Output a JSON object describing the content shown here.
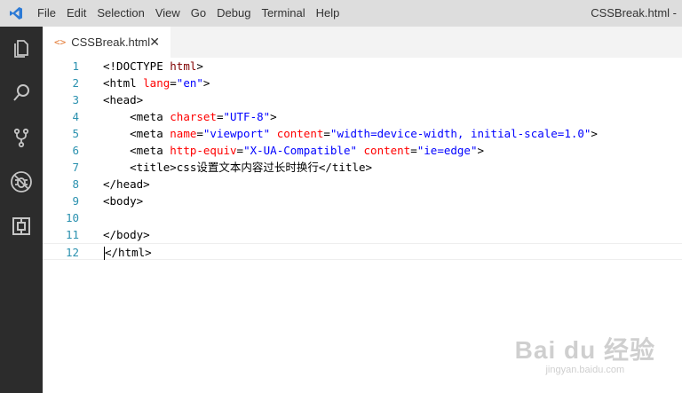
{
  "menu": [
    "File",
    "Edit",
    "Selection",
    "View",
    "Go",
    "Debug",
    "Terminal",
    "Help"
  ],
  "window_title": "CSSBreak.html -",
  "activity_icons": [
    "files-icon",
    "search-icon",
    "source-control-icon",
    "debug-icon",
    "extensions-icon"
  ],
  "tab": {
    "icon": "<>",
    "label": "CSSBreak.html",
    "close": "✕"
  },
  "lines": [
    {
      "n": "1",
      "parts": [
        {
          "c": "k",
          "t": "<!DOCTYPE "
        },
        {
          "c": "t",
          "t": "html"
        },
        {
          "c": "k",
          "t": ">"
        }
      ]
    },
    {
      "n": "2",
      "parts": [
        {
          "c": "k",
          "t": "<html "
        },
        {
          "c": "a",
          "t": "lang"
        },
        {
          "c": "k",
          "t": "="
        },
        {
          "c": "v",
          "t": "\"en\""
        },
        {
          "c": "k",
          "t": ">"
        }
      ]
    },
    {
      "n": "3",
      "parts": [
        {
          "c": "k",
          "t": "<head>"
        }
      ]
    },
    {
      "n": "4",
      "parts": [
        {
          "c": "k",
          "t": "    <meta "
        },
        {
          "c": "a",
          "t": "charset"
        },
        {
          "c": "k",
          "t": "="
        },
        {
          "c": "v",
          "t": "\"UTF-8\""
        },
        {
          "c": "k",
          "t": ">"
        }
      ]
    },
    {
      "n": "5",
      "parts": [
        {
          "c": "k",
          "t": "    <meta "
        },
        {
          "c": "a",
          "t": "name"
        },
        {
          "c": "k",
          "t": "="
        },
        {
          "c": "v",
          "t": "\"viewport\""
        },
        {
          "c": "k",
          "t": " "
        },
        {
          "c": "a",
          "t": "content"
        },
        {
          "c": "k",
          "t": "="
        },
        {
          "c": "v",
          "t": "\"width=device-width, initial-scale=1.0\""
        },
        {
          "c": "k",
          "t": ">"
        }
      ]
    },
    {
      "n": "6",
      "parts": [
        {
          "c": "k",
          "t": "    <meta "
        },
        {
          "c": "a",
          "t": "http-equiv"
        },
        {
          "c": "k",
          "t": "="
        },
        {
          "c": "v",
          "t": "\"X-UA-Compatible\""
        },
        {
          "c": "k",
          "t": " "
        },
        {
          "c": "a",
          "t": "content"
        },
        {
          "c": "k",
          "t": "="
        },
        {
          "c": "v",
          "t": "\"ie=edge\""
        },
        {
          "c": "k",
          "t": ">"
        }
      ]
    },
    {
      "n": "7",
      "parts": [
        {
          "c": "k",
          "t": "    <title>css设置文本内容过长时换行</title>"
        }
      ]
    },
    {
      "n": "8",
      "parts": [
        {
          "c": "k",
          "t": "</head>"
        }
      ]
    },
    {
      "n": "9",
      "parts": [
        {
          "c": "k",
          "t": "<body>"
        }
      ]
    },
    {
      "n": "10",
      "parts": []
    },
    {
      "n": "11",
      "parts": [
        {
          "c": "k",
          "t": "</body>"
        }
      ]
    },
    {
      "n": "12",
      "parts": [
        {
          "c": "k",
          "t": "</html>"
        }
      ],
      "current": true
    }
  ],
  "watermark": {
    "main": "Bai du 经验",
    "sub": "jingyan.baidu.com"
  }
}
